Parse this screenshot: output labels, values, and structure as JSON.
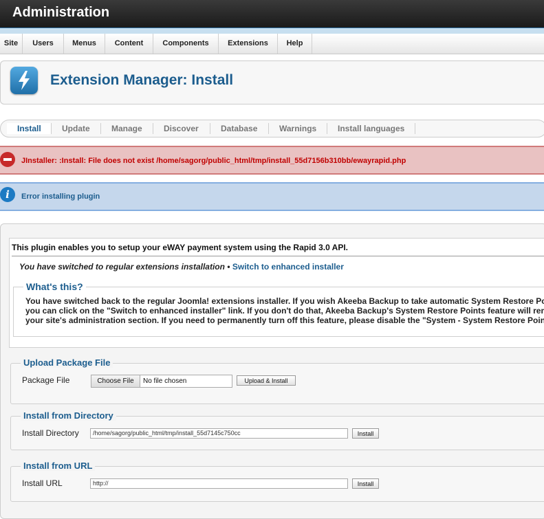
{
  "app": {
    "title": "Administration"
  },
  "menu": [
    "Site",
    "Users",
    "Menus",
    "Content",
    "Components",
    "Extensions",
    "Help"
  ],
  "page": {
    "title": "Extension Manager: Install",
    "icon": "lightning-icon"
  },
  "tabs": [
    "Install",
    "Update",
    "Manage",
    "Discover",
    "Database",
    "Warnings",
    "Install languages"
  ],
  "active_tab": "Install",
  "messages": {
    "error": "JInstaller: :Install: File does not exist /home/sagorg/public_html/tmp/install_55d7156b310bb/ewayrapid.php",
    "info": "Error installing plugin"
  },
  "description": {
    "text": "This plugin enables you to setup your eWAY payment system using the Rapid 3.0 API.",
    "switched_text": "You have switched to regular extensions installation",
    "bullet": "•",
    "switch_link": "Switch to enhanced installer",
    "whats_title": "What's this?",
    "whats_lines": [
      "You have switched back to the regular Joomla! extensions installer. If you wish Akeeba Backup to take automatic System Restore Po",
      "you can click on the \"Switch to enhanced installer\" link. If you don't do that, Akeeba Backup's System Restore Points feature will rem",
      "your site's administration section. If you need to permanently turn off this feature, please disable the \"System - System Restore Point"
    ]
  },
  "upload": {
    "legend": "Upload Package File",
    "label": "Package File",
    "choose_label": "Choose File",
    "no_file": "No file chosen",
    "button": "Upload & Install"
  },
  "directory": {
    "legend": "Install from Directory",
    "label": "Install Directory",
    "value": "/home/sagorg/public_html/tmp/install_55d7145c750cc",
    "button": "Install"
  },
  "url": {
    "legend": "Install from URL",
    "label": "Install URL",
    "value": "http://",
    "button": "Install"
  },
  "colors": {
    "accent": "#1c5d8e",
    "error": "#c00000",
    "header": "#222222"
  }
}
